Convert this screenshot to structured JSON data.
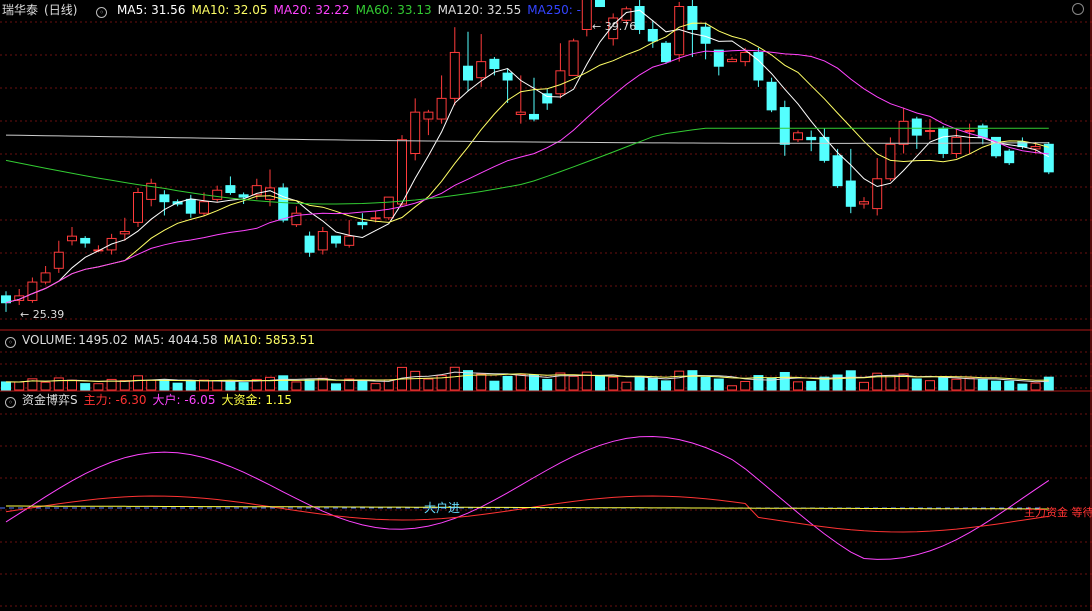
{
  "chart_data": [
    {
      "type": "candlestick",
      "stock": "瑞华泰",
      "period": "(日线)",
      "ylim": [
        24.0,
        37.5
      ],
      "ma_legend": [
        {
          "label": "MA5: 31.56",
          "color": "#ffffff"
        },
        {
          "label": "MA10: 32.05",
          "color": "#ffff66"
        },
        {
          "label": "MA20: 32.22",
          "color": "#ff44ff"
        },
        {
          "label": "MA60: 33.13",
          "color": "#33cc33"
        },
        {
          "label": "MA120: 32.55",
          "color": "#dddddd"
        },
        {
          "label": "MA250: -",
          "color": "#3344ff"
        }
      ],
      "high_label": "39.76",
      "low_label": "25.39",
      "candles": [
        [
          25.4,
          25.1,
          25.6,
          24.7
        ],
        [
          25.2,
          25.4,
          25.7,
          25.0
        ],
        [
          25.2,
          26.0,
          26.2,
          25.1
        ],
        [
          26.0,
          26.4,
          26.7,
          25.9
        ],
        [
          26.6,
          27.3,
          27.8,
          26.4
        ],
        [
          27.8,
          28.0,
          28.4,
          27.6
        ],
        [
          27.9,
          27.7,
          28.0,
          27.5
        ],
        [
          27.4,
          27.4,
          27.6,
          27.3
        ],
        [
          27.4,
          27.9,
          28.1,
          27.2
        ],
        [
          28.1,
          28.2,
          28.8,
          27.8
        ],
        [
          28.6,
          29.9,
          30.1,
          28.4
        ],
        [
          29.6,
          30.3,
          30.5,
          29.3
        ],
        [
          29.8,
          29.5,
          30.0,
          28.9
        ],
        [
          29.5,
          29.4,
          29.6,
          29.3
        ],
        [
          29.6,
          29.0,
          29.8,
          28.8
        ],
        [
          29.0,
          29.5,
          29.9,
          28.9
        ],
        [
          29.6,
          30.0,
          30.2,
          29.5
        ],
        [
          30.2,
          29.9,
          30.6,
          29.8
        ],
        [
          29.8,
          29.7,
          29.9,
          29.4
        ],
        [
          29.8,
          30.2,
          30.5,
          29.6
        ],
        [
          29.6,
          30.1,
          30.9,
          29.3
        ],
        [
          30.1,
          28.7,
          30.3,
          28.6
        ],
        [
          28.5,
          29.0,
          29.3,
          28.4
        ],
        [
          28.0,
          27.3,
          28.2,
          27.1
        ],
        [
          27.4,
          28.2,
          28.4,
          27.2
        ],
        [
          28.0,
          27.7,
          28.0,
          27.5
        ],
        [
          27.6,
          28.0,
          28.7,
          27.5
        ],
        [
          28.6,
          28.5,
          29.0,
          28.3
        ],
        [
          28.8,
          28.8,
          29.1,
          28.6
        ],
        [
          28.8,
          29.7,
          29.7,
          28.7
        ],
        [
          29.4,
          32.2,
          32.4,
          29.3
        ],
        [
          31.6,
          33.4,
          34.0,
          31.3
        ],
        [
          33.1,
          33.4,
          33.5,
          32.4
        ],
        [
          33.1,
          34.0,
          35.0,
          32.9
        ],
        [
          34.0,
          36.0,
          37.1,
          33.7
        ],
        [
          35.4,
          34.8,
          36.9,
          34.3
        ],
        [
          34.9,
          35.6,
          36.8,
          34.5
        ],
        [
          35.7,
          35.3,
          35.8,
          35.0
        ],
        [
          35.1,
          34.8,
          35.3,
          33.8
        ],
        [
          33.3,
          33.4,
          35.0,
          32.9
        ],
        [
          33.3,
          33.1,
          34.9,
          33.0
        ],
        [
          34.2,
          33.8,
          34.4,
          33.5
        ],
        [
          34.2,
          35.2,
          36.4,
          34.0
        ],
        [
          35.0,
          36.5,
          36.6,
          35.0
        ],
        [
          37.0,
          38.8,
          39.4,
          36.7
        ],
        [
          39.0,
          38.0,
          39.8,
          38.0
        ],
        [
          36.6,
          37.5,
          37.7,
          36.3
        ],
        [
          37.4,
          37.9,
          38.0,
          37.2
        ],
        [
          38.0,
          37.0,
          38.5,
          36.8
        ],
        [
          37.0,
          36.5,
          37.4,
          36.2
        ],
        [
          36.4,
          35.6,
          36.5,
          35.5
        ],
        [
          35.9,
          38.0,
          38.2,
          35.6
        ],
        [
          38.0,
          37.0,
          38.3,
          35.8
        ],
        [
          37.1,
          36.4,
          37.3,
          35.7
        ],
        [
          36.1,
          35.4,
          36.1,
          35.0
        ],
        [
          35.6,
          35.7,
          35.8,
          35.6
        ],
        [
          35.6,
          36.0,
          36.2,
          35.4
        ],
        [
          36.0,
          34.8,
          36.2,
          34.5
        ],
        [
          34.7,
          33.5,
          34.9,
          33.4
        ],
        [
          33.6,
          32.0,
          33.9,
          31.5
        ],
        [
          32.2,
          32.5,
          32.6,
          32.1
        ],
        [
          32.3,
          32.2,
          32.6,
          31.7
        ],
        [
          32.3,
          31.3,
          32.7,
          31.2
        ],
        [
          31.5,
          30.2,
          31.8,
          30.1
        ],
        [
          30.4,
          29.3,
          31.8,
          29.0
        ],
        [
          29.4,
          29.5,
          29.7,
          29.2
        ],
        [
          29.2,
          30.5,
          31.4,
          28.9
        ],
        [
          30.5,
          32.0,
          32.3,
          30.4
        ],
        [
          32.0,
          33.0,
          33.6,
          31.6
        ],
        [
          33.1,
          32.4,
          33.2,
          31.8
        ],
        [
          32.6,
          32.6,
          33.1,
          32.2
        ],
        [
          32.7,
          31.6,
          32.8,
          31.4
        ],
        [
          31.6,
          32.3,
          32.7,
          31.4
        ],
        [
          32.6,
          32.6,
          32.9,
          31.6
        ],
        [
          32.8,
          32.3,
          32.9,
          32.0
        ],
        [
          32.3,
          31.5,
          32.3,
          31.4
        ],
        [
          31.7,
          31.2,
          31.8,
          31.1
        ],
        [
          32.1,
          31.9,
          32.3,
          31.8
        ],
        [
          31.8,
          31.9,
          32.1,
          31.6
        ],
        [
          32.0,
          30.8,
          32.1,
          30.7
        ]
      ]
    },
    {
      "type": "bar",
      "title": "VOLUME:",
      "legend": [
        {
          "label": "1495.02",
          "color": "#dddddd"
        },
        {
          "label": "MA5: 4044.58",
          "color": "#dddddd"
        },
        {
          "label": "MA10: 5853.51",
          "color": "#ffff66"
        }
      ],
      "ylim": [
        0,
        20000
      ]
    },
    {
      "type": "line",
      "title": "资金博弈S",
      "legend": [
        {
          "label": "主力: -6.30",
          "color": "#ff3333"
        },
        {
          "label": "大户: -6.05",
          "color": "#ff44ff"
        },
        {
          "label": "大资金: 1.15",
          "color": "#ffff44"
        }
      ],
      "annotation": "大户进",
      "right_text": "主力资金 等待 大户 等",
      "ylim": [
        -100,
        100
      ]
    }
  ]
}
